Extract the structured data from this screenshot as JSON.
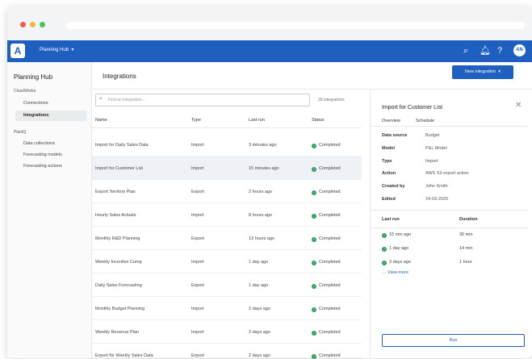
{
  "topbar": {
    "hub_label": "Planning Hub",
    "avatar": "AN"
  },
  "sidebar": {
    "title": "Planning Hub",
    "groups": [
      {
        "label": "CloudWorks",
        "items": [
          "Connections",
          "Integrations"
        ]
      },
      {
        "label": "PlanIQ",
        "items": [
          "Data collections",
          "Forecasting models",
          "Forecasting actions"
        ]
      }
    ]
  },
  "main": {
    "title": "Integrations",
    "new_button": "New integration",
    "search_placeholder": "Find an integration...",
    "count": "39 integrations",
    "columns": [
      "Name",
      "Type",
      "Last run",
      "Status"
    ],
    "rows": [
      {
        "name": "Import for Daily Sales Data",
        "type": "Import",
        "last_run": "3 minutes ago",
        "status": "Completed"
      },
      {
        "name": "Import for Customer List",
        "type": "Import",
        "last_run": "15 minutes ago",
        "status": "Completed"
      },
      {
        "name": "Export Territory Plan",
        "type": "Export",
        "last_run": "2 hours ago",
        "status": "Completed"
      },
      {
        "name": "Hourly Sales Actuals",
        "type": "Import",
        "last_run": "8 hours ago",
        "status": "Completed"
      },
      {
        "name": "Monthly R&D Planning",
        "type": "Export",
        "last_run": "13 hours ago",
        "status": "Completed"
      },
      {
        "name": "Weekly Incentive Comp",
        "type": "Import",
        "last_run": "1 day ago",
        "status": "Completed"
      },
      {
        "name": "Daily Sales Forecasting",
        "type": "Export",
        "last_run": "1 day ago",
        "status": "Completed"
      },
      {
        "name": "Monthly Budget Planning",
        "type": "Import",
        "last_run": "2 days ago",
        "status": "Completed"
      },
      {
        "name": "Weekly Revenue Plan",
        "type": "Import",
        "last_run": "2 days ago",
        "status": "Completed"
      },
      {
        "name": "Export for Weekly Sales Data",
        "type": "Export",
        "last_run": "2 days ago",
        "status": "Completed"
      }
    ]
  },
  "panel": {
    "title": "Import for Customer List",
    "tabs": [
      "Overview",
      "Schedule"
    ],
    "details": [
      {
        "label": "Data source",
        "value": "Budget"
      },
      {
        "label": "Model",
        "value": "P&L Model"
      },
      {
        "label": "Type",
        "value": "Import"
      },
      {
        "label": "Action",
        "value": "AWS S3 export action"
      },
      {
        "label": "Created by",
        "value": "John Smith"
      },
      {
        "label": "Edited",
        "value": "24-03-2020"
      }
    ],
    "runs_header": {
      "last_run": "Last run",
      "duration": "Duration"
    },
    "runs": [
      {
        "when": "15 min ago",
        "duration": "30 min"
      },
      {
        "when": "1 day ago",
        "duration": "14 min"
      },
      {
        "when": "3 days ago",
        "duration": "1 hour"
      }
    ],
    "view_more": "View more",
    "run_button": "Run"
  },
  "colors": {
    "brand": "#1f5fbf",
    "success": "#2e9e5b"
  }
}
